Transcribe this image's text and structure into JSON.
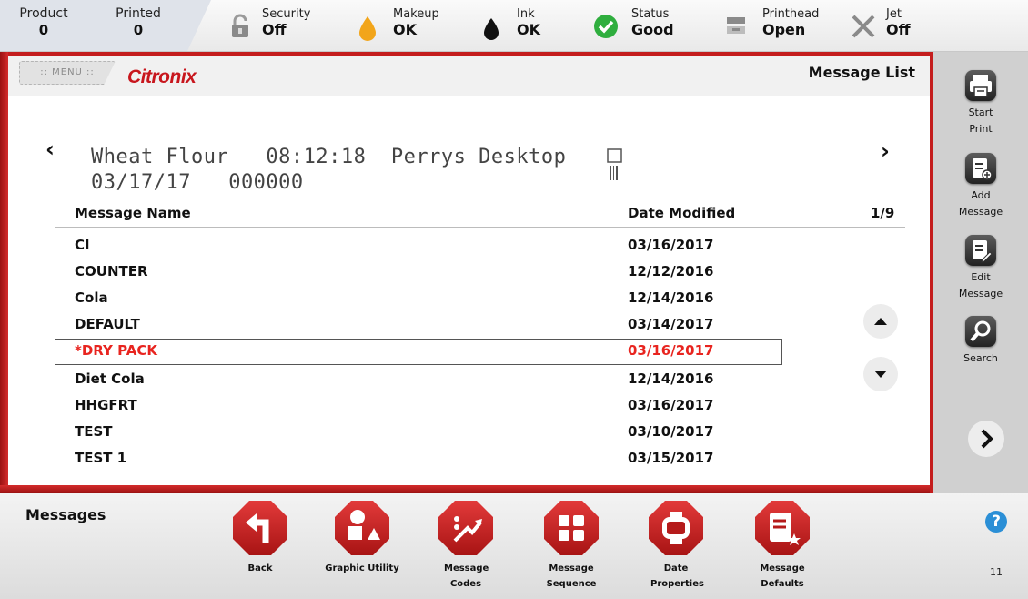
{
  "status_bar": {
    "product": {
      "label": "Product",
      "value": "0"
    },
    "printed": {
      "label": "Printed",
      "value": "0"
    },
    "security": {
      "label": "Security",
      "value": "Off",
      "icon": "lock-icon"
    },
    "makeup": {
      "label": "Makeup",
      "value": "OK",
      "icon": "makeup-drop-icon",
      "color": "#f2a51a"
    },
    "ink": {
      "label": "Ink",
      "value": "OK",
      "icon": "ink-drop-icon",
      "color": "#111111"
    },
    "status": {
      "label": "Status",
      "value": "Good",
      "icon": "check-circle-icon",
      "color": "#2fae3e"
    },
    "printhead": {
      "label": "Printhead",
      "value": "Open",
      "icon": "printhead-icon"
    },
    "jet": {
      "label": "Jet",
      "value": "Off",
      "icon": "x-icon"
    }
  },
  "header": {
    "menu_label": ":: MENU ::",
    "logo_text": "Citronix",
    "title": "Message List"
  },
  "preview": {
    "line1": "Wheat Flour   08:12:18  Perrys Desktop",
    "line2": "03/17/17   000000"
  },
  "message_list": {
    "col_name": "Message Name",
    "col_date": "Date Modified",
    "page": "1/9",
    "rows": [
      {
        "name": "CI",
        "date": "03/16/2017"
      },
      {
        "name": "COUNTER",
        "date": "12/12/2016"
      },
      {
        "name": "Cola",
        "date": "12/14/2016"
      },
      {
        "name": "DEFAULT",
        "date": "03/14/2017"
      },
      {
        "name": "*DRY PACK",
        "date": "03/16/2017",
        "selected": true
      },
      {
        "name": "Diet Cola",
        "date": "12/14/2016"
      },
      {
        "name": "HHGFRT",
        "date": "03/16/2017"
      },
      {
        "name": "TEST",
        "date": "03/10/2017"
      },
      {
        "name": "TEST 1",
        "date": "03/15/2017"
      }
    ]
  },
  "sidebar": {
    "start_print": "Start Print",
    "add_message": "Add Message",
    "edit_message": "Edit Message",
    "search": "Search"
  },
  "bottom_bar": {
    "title": "Messages",
    "buttons": [
      {
        "label": "Back",
        "icon": "back-arrow-icon"
      },
      {
        "label": "Graphic Utility",
        "icon": "shapes-icon"
      },
      {
        "label": "Message Codes",
        "icon": "codes-icon"
      },
      {
        "label": "Message Sequence",
        "icon": "sequence-grid-icon"
      },
      {
        "label": "Date Properties",
        "icon": "calendar-watch-icon"
      },
      {
        "label": "Message Defaults",
        "icon": "defaults-doc-icon"
      }
    ],
    "page_number": "11"
  },
  "colors": {
    "brand_red": "#c8161d",
    "selected_text": "#e8241f",
    "sidebar_bg": "#d0d0d0"
  }
}
